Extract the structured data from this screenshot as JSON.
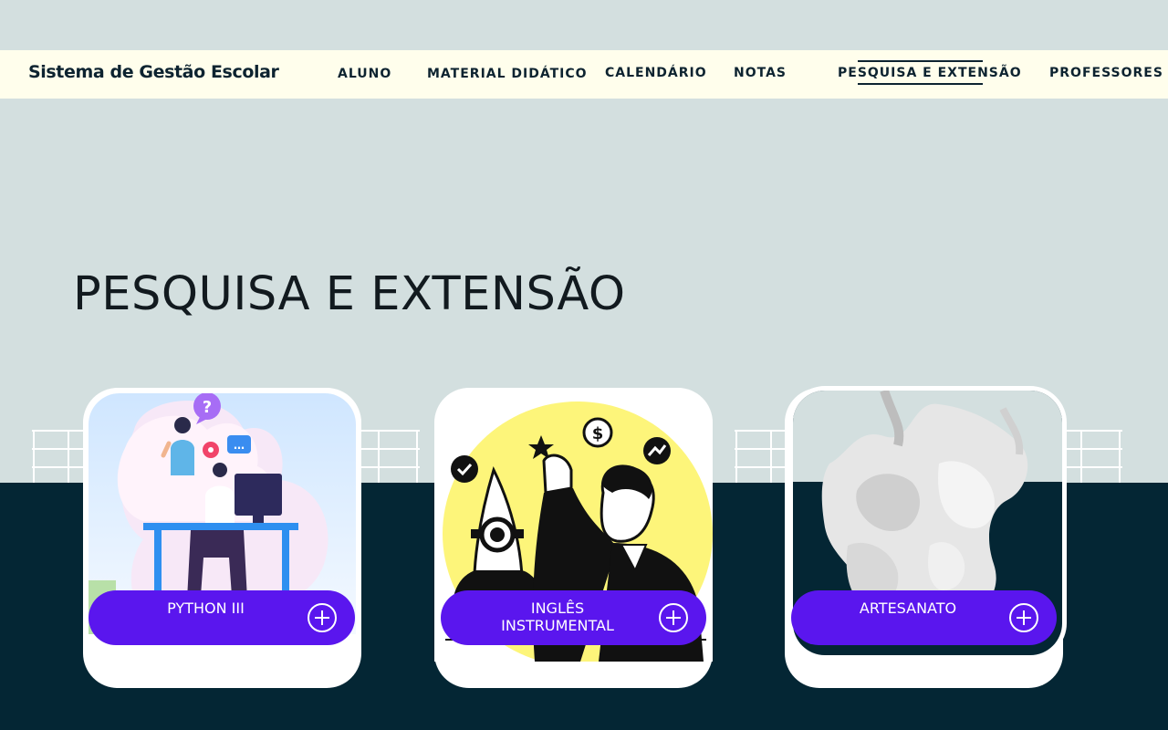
{
  "header": {
    "brand": "Sistema de Gestão Escolar",
    "nav": [
      {
        "label": "ALUNO"
      },
      {
        "label": "MATERIAL DIDÁTICO"
      },
      {
        "label": "CALENDÁRIO"
      },
      {
        "label": "NOTAS"
      },
      {
        "label": "PESQUISA E EXTENSÃO",
        "active": true
      },
      {
        "label": "PROFESSORES"
      }
    ]
  },
  "main": {
    "title": "PESQUISA E EXTENSÃO",
    "cards": [
      {
        "label": "PYTHON III",
        "image": "programmer-at-desk-illustration"
      },
      {
        "label": "INGLÊS INSTRUMENTAL",
        "label_lines": [
          "INGLÊS",
          "INSTRUMENTAL"
        ],
        "image": "rocket-businessman-illustration"
      },
      {
        "label": "ARTESANATO",
        "image": "marble-sculpture-photo"
      }
    ]
  },
  "colors": {
    "background": "#d3dfdf",
    "navbar": "#fffeec",
    "dark_band": "#042634",
    "accent": "#5a16ee",
    "text": "#0d2330"
  }
}
